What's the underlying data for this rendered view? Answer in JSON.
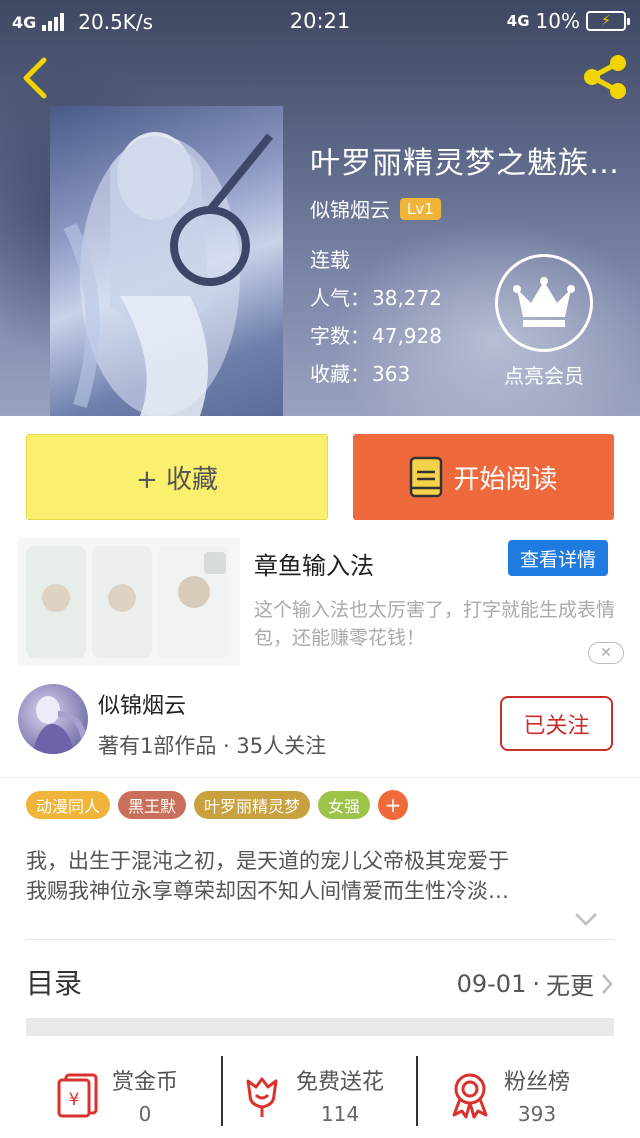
{
  "status_bar": {
    "network": "4G",
    "speed": "20.5K/s",
    "time": "20:21",
    "network_right": "4G",
    "battery": "10%"
  },
  "header": {
    "back_icon": "back-chevron-icon",
    "share_icon": "share-icon",
    "book_title": "叶罗丽精灵梦之魅族…",
    "author": "似锦烟云",
    "level": "Lv1",
    "status": "连载",
    "popularity_label": "人气：",
    "popularity": "38,272",
    "words_label": "字数：",
    "words": "47,928",
    "favorites_label": "收藏：",
    "favorites": "363",
    "vip_label": "点亮会员"
  },
  "actions": {
    "favorite_label": "+ 收藏",
    "read_label": "开始阅读"
  },
  "ad": {
    "title": "章鱼输入法",
    "button": "查看详情",
    "description": "这个输入法也太厉害了，打字就能生成表情包，还能赚零花钱！"
  },
  "author_card": {
    "name": "似锦烟云",
    "info": "著有1部作品 · 35人关注",
    "follow_label": "已关注"
  },
  "tags": [
    {
      "label": "动漫同人",
      "color": "#f0b43a"
    },
    {
      "label": "黑王默",
      "color": "#c8705c"
    },
    {
      "label": "叶罗丽精灵梦",
      "color": "#c9a13e"
    },
    {
      "label": "女强",
      "color": "#9cc44a"
    }
  ],
  "tag_add": "+",
  "intro": {
    "line1": "我，出生于混沌之初，是天道的宠儿父帝极其宠爱于",
    "line2": "我赐我神位永享尊荣却因不知人间情爱而生性冷淡…"
  },
  "toc": {
    "title": "目录",
    "date": "09-01",
    "dot": "·",
    "update": "无更"
  },
  "bottom": {
    "reward_label": "赏金币",
    "reward_value": "0",
    "flower_label": "免费送花",
    "flower_value": "114",
    "fans_label": "粉丝榜",
    "fans_value": "393"
  },
  "colors": {
    "fav_button": "#fbef6e",
    "read_button": "#ee6a3c",
    "follow": "#c92f2a",
    "ad_button": "#1f7be0",
    "icon_red": "#d9322c"
  }
}
